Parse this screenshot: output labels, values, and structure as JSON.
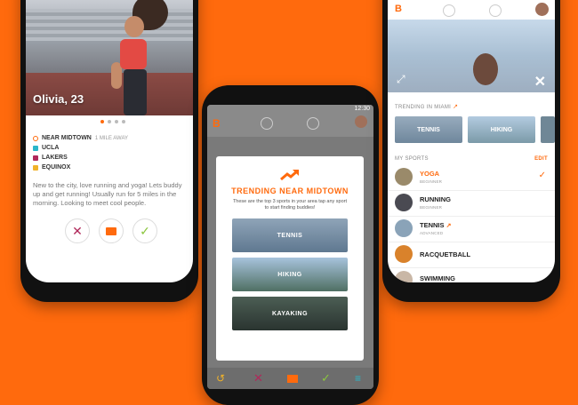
{
  "colors": {
    "background": "#ff6a0d",
    "accent": "#ff6a0d",
    "reject": "#b0285a",
    "accept": "#8cc63f"
  },
  "profile": {
    "name": "Olivia, 23",
    "details": [
      {
        "icon": "location-pin-icon",
        "label": "NEAR MIDTOWN",
        "sub": "1 MILE AWAY",
        "color": "#ff6a0d"
      },
      {
        "icon": "school-icon",
        "label": "UCLA",
        "sub": "",
        "color": "#2bb6c9"
      },
      {
        "icon": "team-icon",
        "label": "LAKERS",
        "sub": "",
        "color": "#b0285a"
      },
      {
        "icon": "gym-icon",
        "label": "EQUINOX",
        "sub": "",
        "color": "#f0b22a"
      }
    ],
    "bio": "New to the city, love running and yoga! Lets buddy up and get running! Usually run for 5 miles in the morning. Looking to meet cool people."
  },
  "trending_modal": {
    "title": "TRENDING NEAR MIDTOWN",
    "subtitle": "These are the top 3 sports in your area tap any sport to start finding buddies!",
    "status_time": "12:30",
    "cards": [
      "TENNIS",
      "HIKING",
      "KAYAKING"
    ]
  },
  "sports_screen": {
    "trending_label": "TRENDING IN MIAMI",
    "trending_tiles": [
      "TENNIS",
      "HIKING"
    ],
    "my_sports_label": "MY SPORTS",
    "edit_label": "EDIT",
    "sports": [
      {
        "name": "YOGA",
        "level": "BEGINNER",
        "selected": true,
        "color": "#9a8a6a"
      },
      {
        "name": "RUNNING",
        "level": "BEGINNER",
        "selected": false,
        "color": "#4a4a52"
      },
      {
        "name": "TENNIS",
        "level": "ADVANCED",
        "selected": false,
        "color": "#8aa3b8",
        "trending": true
      },
      {
        "name": "RACQUETBALL",
        "level": "",
        "selected": false,
        "color": "#d9822b"
      },
      {
        "name": "SWIMMING",
        "level": "",
        "selected": false,
        "color": "#c9b7a6"
      }
    ]
  }
}
